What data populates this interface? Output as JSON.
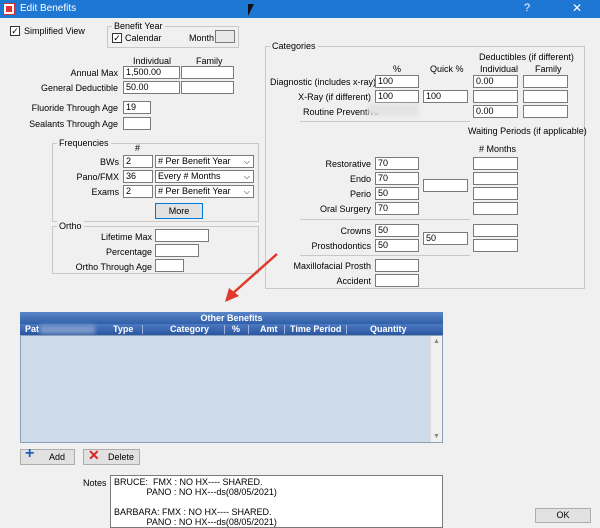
{
  "window": {
    "title": "Edit Benefits",
    "help_glyph": "?",
    "close_glyph": "✕"
  },
  "simplified_view": {
    "label": "Simplified View",
    "checked": "✓"
  },
  "benefit_year": {
    "group_title": "Benefit Year",
    "calendar_label": "Calendar",
    "calendar_checked": "✓",
    "month_label": "Month",
    "month_value": ""
  },
  "general": {
    "individual_header": "Individual",
    "family_header": "Family",
    "annual_max_label": "Annual Max",
    "annual_max_individual": "1,500.00",
    "annual_max_family": "",
    "general_deductible_label": "General Deductible",
    "general_deductible_individual": "50.00",
    "general_deductible_family": "",
    "fluoride_label": "Fluoride Through Age",
    "fluoride_value": "19",
    "sealants_label": "Sealants Through Age",
    "sealants_value": ""
  },
  "frequencies": {
    "group_title": "Frequencies",
    "hash_header": "#",
    "bws_label": "BWs",
    "bws_count": "2",
    "bws_period": "# Per Benefit Year",
    "pano_label": "Pano/FMX",
    "pano_count": "36",
    "pano_period": "Every # Months",
    "exams_label": "Exams",
    "exams_count": "2",
    "exams_period": "# Per Benefit Year",
    "more_label": "More",
    "dropdown_arrow": "⌵"
  },
  "ortho": {
    "group_title": "Ortho",
    "lifetime_max_label": "Lifetime Max",
    "lifetime_max_value": "",
    "percentage_label": "Percentage",
    "percentage_value": "",
    "through_age_label": "Ortho Through Age",
    "through_age_value": ""
  },
  "categories": {
    "group_title": "Categories",
    "pct_header": "%",
    "quick_pct_header": "Quick %",
    "deductibles_header": "Deductibles (if different)",
    "ded_individual_header": "Individual",
    "ded_family_header": "Family",
    "waiting_header": "Waiting Periods (if applicable)",
    "months_header": "# Months",
    "diagnostic_label": "Diagnostic (includes x-ray)",
    "diagnostic_pct": "100",
    "diagnostic_ded_ind": "0.00",
    "diagnostic_ded_fam": "",
    "xray_label": "X-Ray (if different)",
    "xray_pct": "100",
    "xray_quick": "100",
    "xray_ded_ind": "",
    "xray_ded_fam": "",
    "routine_label": "Routine Preventive",
    "routine_ded_ind": "0.00",
    "routine_ded_fam": "",
    "restorative_label": "Restorative",
    "restorative_pct": "70",
    "endo_label": "Endo",
    "endo_pct": "70",
    "perio_label": "Perio",
    "perio_pct": "50",
    "oral_surgery_label": "Oral Surgery",
    "oral_surgery_pct": "70",
    "crowns_label": "Crowns",
    "crowns_pct": "50",
    "prostho_label": "Prosthodontics",
    "prostho_pct": "50",
    "prostho_quick": "50",
    "maxillo_label": "Maxillofacial Prosth",
    "maxillo_pct": "",
    "accident_label": "Accident",
    "accident_pct": ""
  },
  "other_benefits": {
    "title": "Other Benefits",
    "columns": [
      "Pat",
      "Type",
      "Category",
      "%",
      "Amt",
      "Time Period",
      "Quantity"
    ],
    "scroll_up": "▲",
    "scroll_down": "▼"
  },
  "actions": {
    "add_label": "Add",
    "add_glyph": "+",
    "delete_label": "Delete",
    "delete_glyph": "✕",
    "ok_label": "OK"
  },
  "notes": {
    "label": "Notes",
    "text": "BRUCE:  FMX : NO HX---- SHARED.\n             PANO : NO HX---ds(08/05/2021)\n\nBARBARA: FMX : NO HX---- SHARED.\n             PANO : NO HX---ds(08/05/2021)"
  },
  "colors": {
    "title_bar": "#1f77d4",
    "grid_header": "#2f5fa8",
    "grid_body": "#ccdbe7",
    "annotation_arrow": "#e03a2c",
    "add_icon": "#1e5fb8",
    "delete_icon": "#d22"
  }
}
